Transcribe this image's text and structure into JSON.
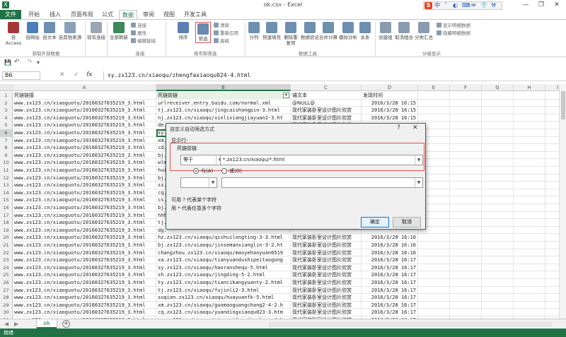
{
  "window": {
    "title": "ok.csv - Excel",
    "min": "—",
    "restore": "❐",
    "close": "✕",
    "help": "?"
  },
  "ime": {
    "logo": "S",
    "glyphs": [
      "中",
      "ˇ",
      "◐",
      "⌨",
      "✉",
      "👕",
      "⚒"
    ]
  },
  "tabs": [
    {
      "label": "文件"
    },
    {
      "label": "开始"
    },
    {
      "label": "插入"
    },
    {
      "label": "页面布局"
    },
    {
      "label": "公式"
    },
    {
      "label": "数据"
    },
    {
      "label": "审阅"
    },
    {
      "label": "视图"
    },
    {
      "label": "开发工具"
    }
  ],
  "ribbon": {
    "buttons": [
      {
        "label": "自 Access",
        "icon": "access-icon",
        "color": "#a4373a"
      },
      {
        "label": "自网站",
        "icon": "web-icon",
        "color": "#4a7ebb"
      },
      {
        "label": "自文本",
        "icon": "text-icon",
        "color": "#6d8fb0"
      },
      {
        "label": "自其他来源",
        "icon": "other-source-icon",
        "color": "#8aa0b8"
      },
      {
        "label": "现有连接",
        "icon": "connection-icon",
        "color": "#9aa6b4"
      },
      {
        "label": "全部刷新",
        "icon": "refresh-icon",
        "color": "#3a8a5a"
      },
      {
        "label": "排序",
        "icon": "sort-icon",
        "color": "#5a7fb0"
      },
      {
        "label": "筛选",
        "icon": "filter-icon",
        "color": "#6a8ab0"
      },
      {
        "label": "分列",
        "icon": "split-icon",
        "color": "#6d8fb0"
      },
      {
        "label": "快速填充",
        "icon": "flash-fill-icon",
        "color": "#6d8fb0"
      },
      {
        "label": "删除重复项",
        "icon": "remove-dup-icon",
        "color": "#6d8fb0"
      },
      {
        "label": "数据验证",
        "icon": "validate-icon",
        "color": "#6d8fb0"
      },
      {
        "label": "合并计算",
        "icon": "consolidate-icon",
        "color": "#6d8fb0"
      },
      {
        "label": "模拟分析",
        "icon": "what-if-icon",
        "color": "#6d8fb0"
      },
      {
        "label": "关系",
        "icon": "relations-icon",
        "color": "#6d8fb0"
      },
      {
        "label": "创建组",
        "icon": "group-icon",
        "color": "#8a9bb0"
      },
      {
        "label": "取消组合",
        "icon": "ungroup-icon",
        "color": "#8a9bb0"
      },
      {
        "label": "分类汇总",
        "icon": "subtotal-icon",
        "color": "#8a9bb0"
      }
    ],
    "small": {
      "connections": [
        "连接",
        "属性",
        "编辑链接"
      ],
      "sortfilter": [
        "清除",
        "重新应用",
        "高级"
      ],
      "outline": [
        "显示明细数据",
        "隐藏明细数据"
      ]
    },
    "groups": [
      "获取外部数据",
      "连接",
      "排序和筛选",
      "数据工具",
      "分级显示"
    ]
  },
  "qat": {
    "save": "💾",
    "undo": "↶",
    "redo": "↷",
    "more": "▾"
  },
  "formula": {
    "namebox": "B6",
    "value": "sy.zx123.cn/xiaoqu/zhengfaxiaoqu024-4.html",
    "cancel": "✕",
    "enter": "✓",
    "fx": "fx"
  },
  "columns": [
    "A",
    "B",
    "C",
    "D",
    "E",
    "F",
    "G",
    "H",
    "I"
  ],
  "rows": [
    {
      "n": "1",
      "a": "死链链接",
      "b": "死链前链",
      "c": "锚文本",
      "d": "发现时间"
    },
    {
      "n": "2",
      "a": "www.zx123.cn/xiaoguotu/20160327635219_3.html",
      "b": "urlreceiver.entry.baidu.com/normal.xml",
      "c": "@NULL@",
      "d": "2016/3/28 16:15"
    },
    {
      "n": "3",
      "a": "www.zx123.cn/xiaoguotu/20160327635219_3.html",
      "b": "tj.zx123.cn/xiaoqu/jingcaishangpin-3.html",
      "c": "现代家装卧室设计图片欣赏",
      "d": "2016/3/28 16:15"
    },
    {
      "n": "4",
      "a": "www.zx123.cn/xiaoguotu/20160327635219_3.html",
      "b": "nj.zx123.cn/xiaoqu/xinlixiangjiayuan2-3.ht",
      "c": "现代家装卧室设计图片欣赏",
      "d": "2016/3/28 16:15"
    },
    {
      "n": "5",
      "a": "www.zx123.cn/xiaoguotu/20160327635219_3.html",
      "b": "de.zx123.cn/xiaoqu/...",
      "c": "现代家装卧室设计图片欣赏",
      "d": "2016/3/28 16:15"
    },
    {
      "n": "6",
      "a": "www.zx123.cn/xiaoguotu/20160327635219_3.html",
      "b": "sy.",
      "c": "",
      "d": ""
    },
    {
      "n": "7",
      "a": "www.zx123.cn/xiaoguotu/20160327635219_3.html",
      "b": "xm.",
      "c": "",
      "d": ""
    },
    {
      "n": "8",
      "a": "www.zx123.cn/xiaoguotu/20160327635219_3.html",
      "b": "cd.",
      "c": "",
      "d": ""
    },
    {
      "n": "9",
      "a": "www.zx123.cn/xiaoguotu/20160327635219_3.html",
      "b": "bj.",
      "c": "",
      "d": ""
    },
    {
      "n": "10",
      "a": "www.zx123.cn/xiaoguotu/20160327635219_3.html",
      "b": "wlm",
      "c": "",
      "d": ""
    },
    {
      "n": "11",
      "a": "www.zx123.cn/xiaoguotu/20160327635219_3.html",
      "b": "hui",
      "c": "",
      "d": ""
    },
    {
      "n": "12",
      "a": "www.zx123.cn/xiaoguotu/20160327635219_3.html",
      "b": "bj.",
      "c": "",
      "d": ""
    },
    {
      "n": "13",
      "a": "www.zx123.cn/xiaoguotu/20160327635219_3.html",
      "b": "sz.",
      "c": "",
      "d": ""
    },
    {
      "n": "14",
      "a": "www.zx123.cn/xiaoguotu/20160327635219_3.html",
      "b": "cq.",
      "c": "",
      "d": ""
    },
    {
      "n": "15",
      "a": "www.zx123.cn/xiaoguotu/20160327635219_3.html",
      "b": "cs.",
      "c": "",
      "d": ""
    },
    {
      "n": "16",
      "a": "www.zx123.cn/xiaoguotu/20160327635219_3.html",
      "b": "bj.",
      "c": "",
      "d": ""
    },
    {
      "n": "17",
      "a": "www.zx123.cn/xiaoguotu/20160327635219_3.html",
      "b": "hhh",
      "c": "",
      "d": ""
    },
    {
      "n": "18",
      "a": "www.zx123.cn/xiaoguotu/20160327635219_3.html",
      "b": "tj.",
      "c": "",
      "d": ""
    },
    {
      "n": "19",
      "a": "www.zx123.cn/xiaoguotu/20160327635219_3.html",
      "b": "dg.",
      "c": "",
      "d": ""
    },
    {
      "n": "20",
      "a": "www.zx123.cn/xiaoguotu/20160327635219_3.html",
      "b": "hz.zx123.cn/xiaoqu/qishuilongting-3-3.html",
      "c": "现代家装卧室设计图片欣赏",
      "d": "2016/3/28 16:16"
    },
    {
      "n": "21",
      "a": "www.zx123.cn/xiaoguotu/20160327635219_3.html",
      "b": "bj.zx123.cn/xiaoqu/jinsemanxianglin-3-2.ht",
      "c": "现代家装卧室设计图片欣赏",
      "d": "2016/3/28 16:16"
    },
    {
      "n": "22",
      "a": "www.zx123.cn/xiaoguotu/20160327635219_3.html",
      "b": "changzhou.zx123.cn/xiaoqu/maoyehaoyuan0519",
      "c": "现代家装卧室设计图片欣赏",
      "d": "2016/3/28 16:16"
    },
    {
      "n": "23",
      "a": "www.zx123.cn/xiaoguotu/20160327635219_3.html",
      "b": "xa.zx123.cn/xiaoqu/tianyuandushipeitaogong",
      "c": "现代家装卧室设计图片欣赏",
      "d": "2016/3/28 16:17"
    },
    {
      "n": "24",
      "a": "www.zx123.cn/xiaoguotu/20160327635219_3.html",
      "b": "sy.zx123.cn/xiaoqu/haoranshequ-5.html",
      "c": "现代家装卧室设计图片欣赏",
      "d": "2016/3/28 16:17"
    },
    {
      "n": "25",
      "a": "www.zx123.cn/xiaoguotu/20160327635219_3.html",
      "b": "sh.zx123.cn/xiaoqu/jingding-5-2.html",
      "c": "现代家装卧室设计图片欣赏",
      "d": "2016/3/28 16:17"
    },
    {
      "n": "26",
      "a": "www.zx123.cn/xiaoguotu/20160327635219_3.html",
      "b": "ty.zx123.cn/xiaoqu/tiancikangyuanty-2.html",
      "c": "现代家装卧室设计图片欣赏",
      "d": "2016/3/28 16:17"
    },
    {
      "n": "27",
      "a": "www.zx123.cn/xiaoguotu/20160327635219_3.html",
      "b": "tj.zx123.cn/xiaoqu/fujinli2-3.html",
      "c": "现代家装卧室设计图片欣赏",
      "d": "2016/3/28 16:17"
    },
    {
      "n": "28",
      "a": "www.zx123.cn/xiaoguotu/20160327635219_3.html",
      "b": "suqian.zx123.cn/xiaoqu/huayuanfk-5.html",
      "c": "现代家装卧室设计图片欣赏",
      "d": "2016/3/28 16:17"
    },
    {
      "n": "29",
      "a": "www.zx123.cn/xiaoguotu/20160327635219_3.html",
      "b": "xm.zx123.cn/xiaoqu/guomaoguangchang2-4-2.h",
      "c": "现代家装卧室设计图片欣赏",
      "d": "2016/3/28 16:17"
    },
    {
      "n": "30",
      "a": "www.zx123.cn/xiaoguotu/20160327635219_3.html",
      "b": "cq.zx123.cn/xiaoqu/yuandingxiaoqu023-3.htm",
      "c": "现代家装卧室设计图片欣赏",
      "d": "2016/3/28 16:17"
    },
    {
      "n": "31",
      "a": "www.zx123.cn/xiaoguotu/20160327635219_3.html",
      "b": "cs.zx123.cn/xiaoqu/yiransifangjincheng-4.h",
      "c": "现代家装卧室设计图片欣赏",
      "d": "2016/3/28 16:17"
    }
  ],
  "sheet": {
    "name": "ok",
    "add": "+",
    "prev": "◀",
    "next": "▶"
  },
  "status": {
    "text": "就绪"
  },
  "dialog": {
    "title": "自定义自动筛选方式",
    "help": "?",
    "close": "✕",
    "show_rows": "显示行:",
    "field": "死链前链",
    "op1": "等于",
    "val1": "*.zx123.cn/xiaoqu/*.html",
    "and_label": "与(A)",
    "or_label": "或(O)",
    "op2": "",
    "val2": "",
    "hint1": "可用 ? 代表单个字符",
    "hint2": "用 * 代表任意多个字符",
    "ok": "确定",
    "cancel": "取消"
  }
}
